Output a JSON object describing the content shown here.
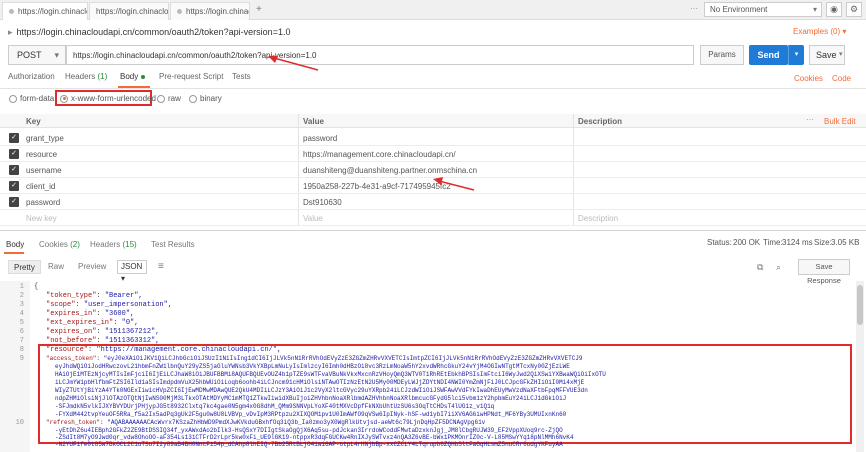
{
  "tabs": [
    {
      "label": "https://login.chinaclou",
      "close": "×"
    },
    {
      "label": "https://login.chinaclo",
      "close": "×"
    },
    {
      "label": "https://login.chinaclo",
      "close": "×"
    }
  ],
  "tabs_add": "+",
  "tabs_more": "···",
  "environment": {
    "selected": "No Environment",
    "caret": "▾"
  },
  "request": {
    "title_caret": "▸",
    "title": "https://login.chinacloudapi.cn/common/oauth2/token?api-version=1.0",
    "examples": "Examples (0) ▾",
    "method": "POST",
    "method_caret": "▾",
    "url": "https://login.chinacloudapi.cn/common/oauth2/token?api-version=1.0",
    "params_label": "Params",
    "send_label": "Send",
    "send_caret": "▾",
    "save_label": "Save",
    "save_caret": "▾"
  },
  "request_tabs": {
    "authorization": "Authorization",
    "headers": "Headers",
    "headers_count": "(1)",
    "body": "Body",
    "prerequest": "Pre-request Script",
    "tests": "Tests",
    "cookies": "Cookies",
    "code": "Code"
  },
  "body_modes": [
    {
      "label": "form-data"
    },
    {
      "label": "x-www-form-urlencoded"
    },
    {
      "label": "raw"
    },
    {
      "label": "binary"
    }
  ],
  "kv_table": {
    "key_header": "Key",
    "value_header": "Value",
    "desc_header": "Description",
    "more": "···",
    "bulk_edit": "Bulk Edit",
    "check_glyph": "✓",
    "rows": [
      {
        "key": "grant_type",
        "value": "password"
      },
      {
        "key": "resource",
        "value": "https://management.core.chinacloudapi.cn/"
      },
      {
        "key": "username",
        "value": "duanshiteng@duanshiteng.partner.onmschina.cn"
      },
      {
        "key": "client_id",
        "value": "1950a258-227b-4e31-a9cf-717495945fc2"
      },
      {
        "key": "password",
        "value": "Dst910630"
      }
    ],
    "new_key": "New key",
    "new_value": "Value",
    "new_desc": "Description"
  },
  "response_tabs": {
    "body": "Body",
    "cookies": "Cookies",
    "cookies_count": "(2)",
    "headers": "Headers",
    "headers_count": "(15)",
    "tests": "Test Results"
  },
  "response_status": {
    "status_label": "Status:",
    "status_value": "200 OK",
    "time_label": "Time:",
    "time_value": "3124 ms",
    "size_label": "Size:",
    "size_value": "3.05 KB"
  },
  "viewer": {
    "pretty": "Pretty",
    "raw": "Raw",
    "preview": "Preview",
    "format": "JSON",
    "format_caret": "▾",
    "wrap_icon": "≡",
    "copy_icon": "⧉",
    "search_icon": "⌕",
    "save_response": "Save Response"
  },
  "json_lines": [
    {
      "n": "1",
      "text": "{"
    },
    {
      "n": "2",
      "key": "\"token_type\"",
      "value": "\"Bearer\","
    },
    {
      "n": "3",
      "key": "\"scope\"",
      "value": "\"user_impersonation\","
    },
    {
      "n": "4",
      "key": "\"expires_in\"",
      "value": "\"3600\","
    },
    {
      "n": "5",
      "key": "\"ext_expires_in\"",
      "value": "\"0\","
    },
    {
      "n": "6",
      "key": "\"expires_on\"",
      "value": "\"1511367212\","
    },
    {
      "n": "7",
      "key": "\"not_before\"",
      "value": "\"1511363312\","
    },
    {
      "n": "8",
      "key": "\"resource\"",
      "value": "\"https://management.core.chinacloudapi.cn/\","
    },
    {
      "n": "9",
      "key": "\"access_token\"",
      "value": "\"eyJ0eXAiOiJKV1QiLCJhbGciOiJSUzI1NiIsIng1dCI6IjJLVk5nN1RrRVhOdEVyZzE3ZGZmZHRvVXVETCIsImtpZCI6IjJLVk5nN1RrRVhOdEVyZzE3ZGZmZHRvVXVETCJ9"
    },
    {
      "n": "10",
      "key": "\"refresh_token\"",
      "value": "\"AQABAAAAAACAcWvrx7KSzaZhHbWD9PmdXJwKVkduGBxhfOq3iQ3b_Ia0zmo3yX0WgRlkUtvjsd-aeWt6c79LjnDqHpZF5DCNAgVpg61v"
    }
  ],
  "token_block_lines": [
    "eyJhdWQiOiJodHRwczovL21hbmFnZW1lbnQuY29yZS5jaGluYWNsb3VkYXBpLmNuLyIsImlzcyI6Imh0dHBzOi8vc3RzLmNoaW5hY2xvdWRhcGkuY24vYjM4OGIwNTgtMTcxNy00ZjEzLWE",
    "HAiOjE1MTEzNjcyMTIsImFjciI6IjEiLCJhaW8iOiJBUFBBMi8AQUFBQUEvOUZ4b1pTZE9sWTFvaVBuNkVkxMxcnRzVHoyQmQ3WTV0T1RhREtEbkhBPSIsImFtciI6WyJwd2QiXSwiYXBwaWQiOiIxOTU",
    "iLCJmYW1pbHlfbmFtZSI6Ild1aSIsImdpdmVuX25hbWUiOiLoqb6oohb4iLCJncm91cHMiOlsiNTAwOTIzNzEtN2U5My00MDEyLWJjZDYtNDI4NWI0YmZmNjFiJ0LCJpcGFkZHIiOiI0Mi4xMjE",
    "WIyZTUtYjBiYzA4YTk0NGExIiwicHVpZCI6IjEwMDMwMDAwQUE2QkU4MDIiLCJzY3AiOiJ1c2VyX2ltcGVyc29uYXRpb24iLCJzdWIiOiJSWFAwVVdFYkIwaDhEUyMwVzdNaXFtbFpqMFFVUE3dn",
    "ndpZHMiOlsiNjJlOTAzOTQtNjIwNS00MjM3LTkxOTAtMDYyMC1mMTQ1ZTkwIiwidXBuIjoiZHVhbnNoaXRlbmdAZHVhbnNoaXRlbmcucGFydG5lci5vbm1zY2hpbmEuY24iLCJ1dGkiOiJ",
    "-SFJmdkN5vlkIJXYBVYDUrjPHjypJG5t8932Clxtq7kc4gae0N5gm4x0G8dhM_QMm9SNNVpLYoXF40tMXVcDpfFkNXbUhtUzSU6s3OqTtCHDsT4lUG1z_v1Q1q",
    "-FYXdM442tvpYeuOF5RRa_f5a2Ix5adPq3gUk2F5gu0w8U8LVBVp_vDvIpM3RPtpzu2XIXQOM1pv1U0ImAWfO9qVSw6IpINyk-hSF-wd1ybI7iiXV6AG6iwHPNdt_MF6YBy3UMUIxnKn60"
  ],
  "refresh_block_lines": [
    "-yEtDhZ6u4IEBph2GFkZ2ZE9BtDSSIQ34f_yxAWxdAo2bIlk3-HsQSxY7DIIgtSkaOgQjX6Aq5su-pdJckan3IrrdoWCoddFMwtaDzxknJgj_JM8lCbgRUJW39_EF2VppXUoq9rc-ZjQO",
    "-ZSdIt8M7yO9Jwd0qr_vdw8OhoOO-aF354Ls131CTFrD2rLpr5kw0xFi_UE9lGK19-ntppxR3dqFGUCKw4RnIXJySWTvxz4nQA3Z6vBE-bWx1PKMOnrIZ0c-V-L85MSwYYq18pNlMMh6NvK4",
    "-N2YUFife0t85w7BkOCL2C1uTSu7I2y89aB4BH0NncF154p_dCAhp8lhEIQ-7Bb25RtBLjO4iwi6AP-otpL4rHNjbBp-xxCZCLY4LTqrupb6ZQHbSltFaGqHLsmZ5nuCRr6udgYKFuyAA"
  ],
  "colors": {
    "accent": "#f26b3a",
    "send": "#1f7bd6",
    "status_ok": "#2a8a3e",
    "annotation": "#e02b2b"
  }
}
